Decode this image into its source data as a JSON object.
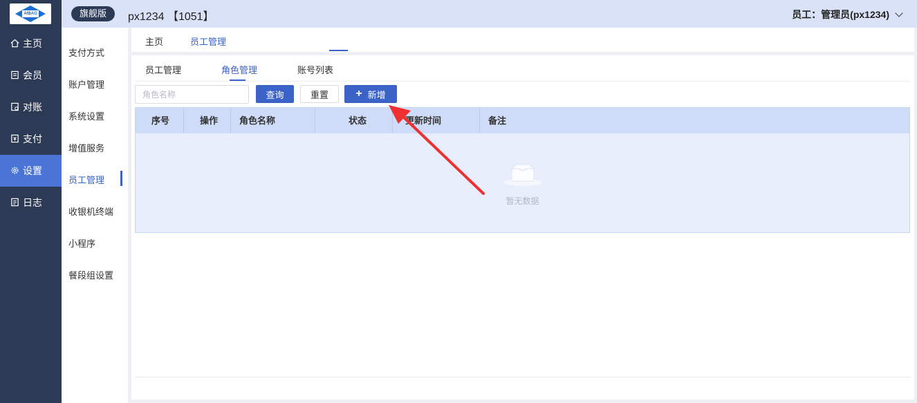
{
  "brand": {
    "logo_text": "AIBAO 爱宝"
  },
  "top": {
    "edition": "旗舰版",
    "store": "px1234 【1051】",
    "user": "员工：管理员(px1234)"
  },
  "nav": [
    {
      "label": "主页",
      "icon": "home-icon"
    },
    {
      "label": "会员",
      "icon": "member-icon"
    },
    {
      "label": "对账",
      "icon": "reconcile-icon"
    },
    {
      "label": "支付",
      "icon": "payment-icon"
    },
    {
      "label": "设置",
      "icon": "gear-icon",
      "active": true
    },
    {
      "label": "日志",
      "icon": "log-icon"
    }
  ],
  "submenu": [
    {
      "label": "支付方式"
    },
    {
      "label": "账户管理"
    },
    {
      "label": "系统设置"
    },
    {
      "label": "增值服务"
    },
    {
      "label": "员工管理",
      "active": true
    },
    {
      "label": "收银机终端"
    },
    {
      "label": "小程序"
    },
    {
      "label": "餐段组设置"
    }
  ],
  "breadcrumb": [
    {
      "label": "主页"
    },
    {
      "label": "员工管理",
      "active": true
    }
  ],
  "tabs": [
    {
      "label": "员工管理"
    },
    {
      "label": "角色管理",
      "active": true
    },
    {
      "label": "账号列表"
    }
  ],
  "filter": {
    "placeholder": "角色名称",
    "query": "查询",
    "reset": "重置",
    "add": "新增"
  },
  "table": {
    "columns": [
      "序号",
      "操作",
      "角色名称",
      "状态",
      "更新时间",
      "备注"
    ],
    "empty_text": "暂无数据"
  },
  "colors": {
    "accent": "#3a62c7",
    "rail": "#2c3a55",
    "arrow": "#f03030"
  }
}
